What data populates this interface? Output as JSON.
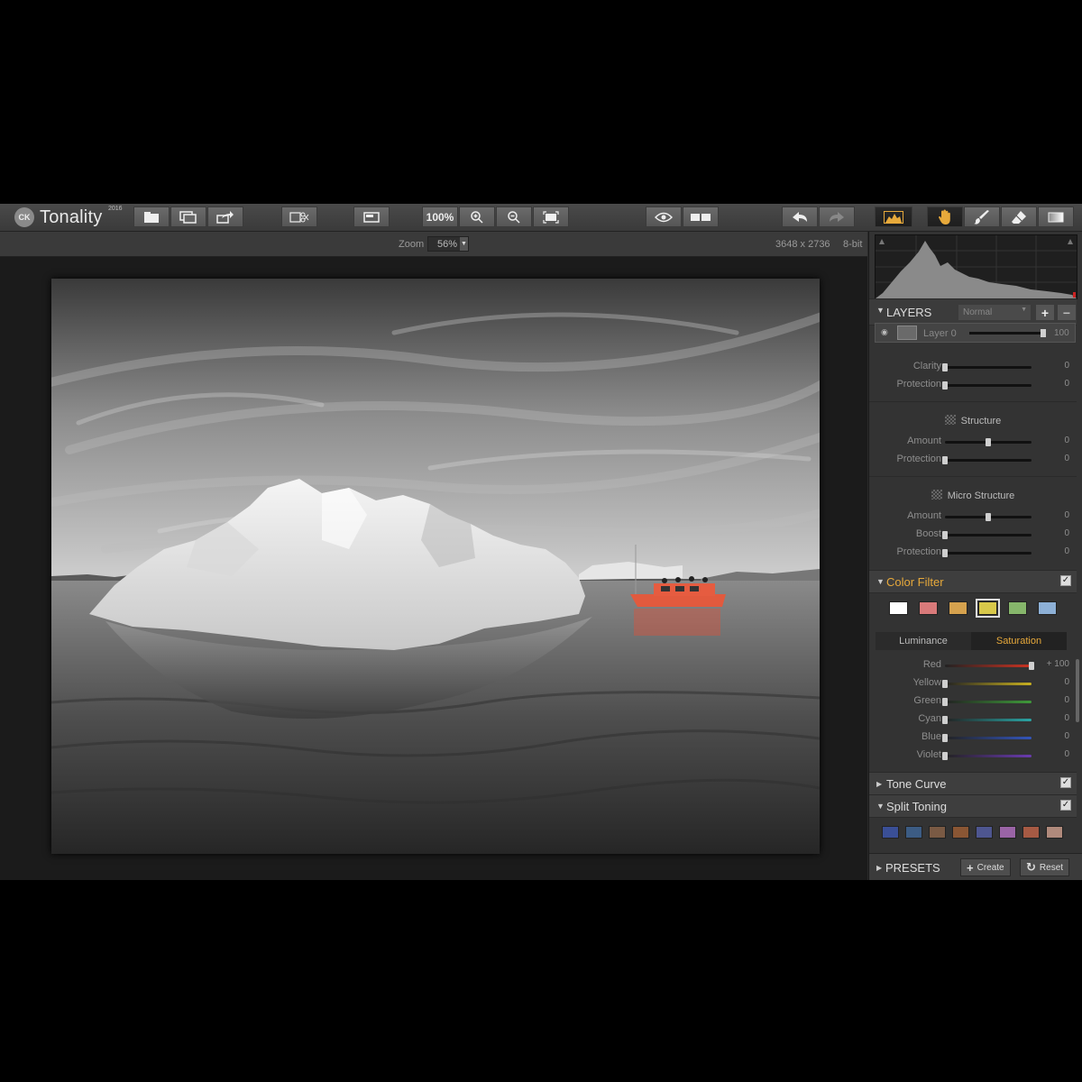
{
  "app": {
    "name": "Tonality",
    "year": "2016",
    "logo_text": "CK"
  },
  "toolbar": {
    "zoom_label": "100%",
    "icons": [
      "open-icon",
      "batch-icon",
      "export-icon",
      "crop-icon",
      "window-icon",
      "zoom-in-icon",
      "zoom-out-icon",
      "fit-icon",
      "preview-eye-icon",
      "compare-icon",
      "undo-icon",
      "redo-icon",
      "histogram-icon",
      "hand-icon",
      "brush-icon",
      "eraser-icon",
      "gradient-icon"
    ]
  },
  "infobar": {
    "zoom_label": "Zoom",
    "zoom_value": "56%",
    "dimensions": "3648 x 2736",
    "bit_depth": "8-bit"
  },
  "layers": {
    "title": "LAYERS",
    "blend_mode": "Normal",
    "add": "+",
    "remove": "−",
    "layer_name": "Layer 0",
    "opacity": "100",
    "opacity_level": 100
  },
  "adjustments": {
    "clarity": {
      "label": "Clarity",
      "value": "0",
      "level": 0
    },
    "clarity_protection": {
      "label": "Protection",
      "value": "0",
      "level": 0
    },
    "structure": {
      "title": "Structure",
      "amount": {
        "label": "Amount",
        "value": "0",
        "level": 0.5
      },
      "protection": {
        "label": "Protection",
        "value": "0",
        "level": 0
      }
    },
    "micro_structure": {
      "title": "Micro Structure",
      "amount": {
        "label": "Amount",
        "value": "0",
        "level": 0.5
      },
      "boost": {
        "label": "Boost",
        "value": "0",
        "level": 0
      },
      "protection": {
        "label": "Protection",
        "value": "0",
        "level": 0
      }
    }
  },
  "color_filter": {
    "title": "Color Filter",
    "checked": "✓",
    "swatches": [
      "#ffffff",
      "#d97a7a",
      "#d6a24e",
      "#d8c84a",
      "#86b66b",
      "#8db0d6"
    ],
    "selected_index": 3,
    "tabs": [
      "Luminance",
      "Saturation"
    ],
    "active_tab": "Saturation",
    "channels": [
      {
        "label": "Red",
        "value": "+ 100",
        "color": "#cc3322",
        "level": 1
      },
      {
        "label": "Yellow",
        "value": "0",
        "color": "#c8b020",
        "level": 0
      },
      {
        "label": "Green",
        "value": "0",
        "color": "#3f9a3a",
        "level": 0
      },
      {
        "label": "Cyan",
        "value": "0",
        "color": "#2aa5a5",
        "level": 0
      },
      {
        "label": "Blue",
        "value": "0",
        "color": "#3355bb",
        "level": 0
      },
      {
        "label": "Violet",
        "value": "0",
        "color": "#6a3bb0",
        "level": 0
      }
    ]
  },
  "tone_curve": {
    "title": "Tone Curve",
    "checked": "✓"
  },
  "split_toning": {
    "title": "Split Toning",
    "checked": "✓",
    "swatches": [
      "#3a4f96",
      "#3c5c84",
      "#7a5a44",
      "#8a5634",
      "#4e5690",
      "#9a64a6",
      "#a65a44",
      "#b08a7c"
    ]
  },
  "presets": {
    "title": "PRESETS",
    "create": "Create",
    "reset": "Reset"
  }
}
